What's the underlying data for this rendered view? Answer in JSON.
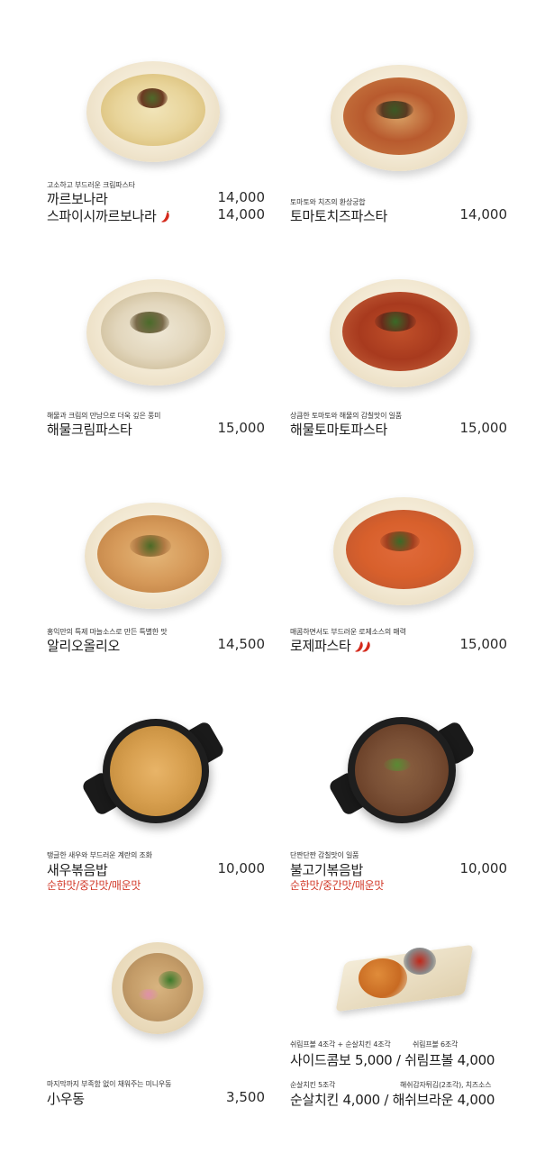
{
  "menu": [
    {
      "desc": "고소하고 부드러운 크림파스타",
      "name": "까르보나라",
      "price": "14,000",
      "name2": "스파이시까르보나라",
      "price2": "14,000"
    },
    {
      "desc": "토마토와 치즈의 환상궁합",
      "name": "토마토치즈파스타",
      "price": "14,000"
    },
    {
      "desc": "해물과 크림의 만남으로 더욱 깊은 풍미",
      "name": "해물크림파스타",
      "price": "15,000"
    },
    {
      "desc": "상큼한 토마토와 해물의 감칠맛이 일품",
      "name": "해물토마토파스타",
      "price": "15,000"
    },
    {
      "desc": "홍익만의 특제 마늘소스로 만든 특별한 맛",
      "name": "알리오올리오",
      "price": "14,500"
    },
    {
      "desc": "매콤하면서도 부드러운 로제소스의 매력",
      "name": "로제파스타",
      "price": "15,000"
    },
    {
      "desc": "탱글한 새우와 부드러운 계란의 조화",
      "name": "새우볶음밥",
      "price": "10,000",
      "options": "순한맛/중간맛/매운맛"
    },
    {
      "desc": "단짠단짠 감칠맛이 일품",
      "name": "불고기볶음밥",
      "price": "10,000",
      "options": "순한맛/중간맛/매운맛"
    },
    {
      "desc": "마지막까지 부족함 없이 채워주는 미니우동",
      "name": "小우동",
      "price": "3,500"
    }
  ],
  "side": {
    "combo_desc": "쉬림프볼 4조각 + 순살치킨 4조각",
    "combo_name": "사이드콤보",
    "combo_price": "5,000",
    "shrimp_desc": "쉬림프볼 6조각",
    "shrimp_name": "쉬림프볼",
    "shrimp_price": "4,000",
    "chicken_desc": "순살치킨 5조각",
    "chicken_name": "순살치킨",
    "chicken_price": "4,000",
    "hash_desc": "해쉬감자튀김(2조각), 치즈소스",
    "hash_name": "해쉬브라운",
    "hash_price": "4,000",
    "separator": "/"
  },
  "colors": {
    "option_red": "#d23a2a",
    "pepper_red": "#d42a1c"
  },
  "icons": {
    "spicy": "chili-pepper-icon"
  }
}
